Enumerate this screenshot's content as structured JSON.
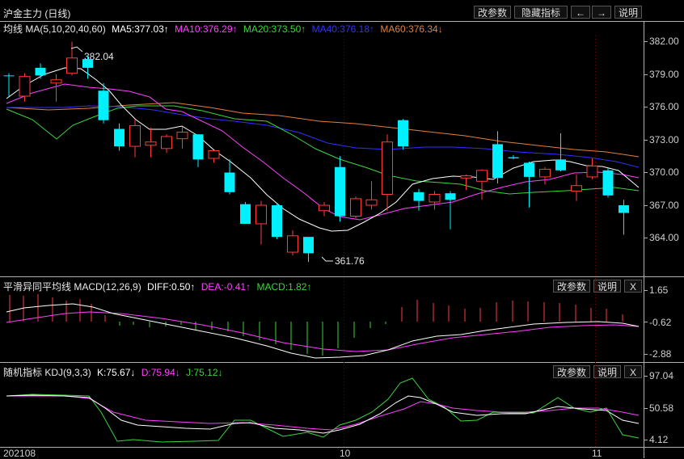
{
  "header": {
    "title": "沪金主力 (日线)",
    "buttons": {
      "modify_params": "改参数",
      "hide_indicator": "隐藏指标",
      "prev": "←",
      "next": "→",
      "help": "说明"
    }
  },
  "main": {
    "ma_info": {
      "label": "均线 MA(5,10,20,40,60)",
      "ma5": "MA5:377.03↑",
      "ma10": "MA10:376.29↑",
      "ma20": "MA20:373.50↑",
      "ma40": "MA40:376.18↑",
      "ma60": "MA60:376.34↓"
    },
    "price_ticks": [
      "382.00",
      "379.00",
      "376.00",
      "373.00",
      "370.00",
      "367.00",
      "364.00"
    ],
    "annotations": {
      "high": "382.04",
      "low": "361.76"
    }
  },
  "macd_pane": {
    "info": {
      "label": "平滑异同平均线 MACD(12,26,9)",
      "diff": "DIFF:0.50↑",
      "dea": "DEA:-0.41↑",
      "macd": "MACD:1.82↑"
    },
    "ticks": [
      "1.65",
      "-0.62",
      "-2.88"
    ],
    "buttons": {
      "modify_params": "改参数",
      "help": "说明",
      "close": "X"
    }
  },
  "kdj_pane": {
    "info": {
      "label": "随机指标 KDJ(9,3,3)",
      "k": "K:75.67↓",
      "d": "D:75.94↓",
      "j": "J:75.12↓"
    },
    "ticks": [
      "97.04",
      "50.58",
      "4.12"
    ],
    "buttons": {
      "modify_params": "改参数",
      "help": "说明",
      "close": "X"
    }
  },
  "x_axis": {
    "labels": [
      "202108",
      "10",
      "11"
    ]
  },
  "colors": {
    "up": "#ff3b3b",
    "down": "#00f0ff",
    "ma5": "#ffffff",
    "ma10": "#ff40ff",
    "ma20": "#3cd63c",
    "ma40": "#3030ff",
    "ma60": "#e08040"
  },
  "chart_data": {
    "type": "candlestick",
    "ylim": [
      362.5,
      383.5
    ],
    "candles": [
      {
        "o": 378.9,
        "h": 379.1,
        "l": 377.0,
        "c": 378.9,
        "dir": "down"
      },
      {
        "o": 377.0,
        "h": 379.1,
        "l": 376.5,
        "c": 378.8,
        "dir": "up"
      },
      {
        "o": 379.6,
        "h": 380.0,
        "l": 378.6,
        "c": 378.9,
        "dir": "down"
      },
      {
        "o": 378.2,
        "h": 379.0,
        "l": 376.5,
        "c": 378.5,
        "dir": "up"
      },
      {
        "o": 379.1,
        "h": 382.0,
        "l": 378.9,
        "c": 380.5,
        "dir": "up"
      },
      {
        "o": 380.4,
        "h": 380.7,
        "l": 378.6,
        "c": 379.6,
        "dir": "down"
      },
      {
        "o": 377.5,
        "h": 378.2,
        "l": 374.5,
        "c": 374.8,
        "dir": "down"
      },
      {
        "o": 374.0,
        "h": 374.5,
        "l": 372.0,
        "c": 372.4,
        "dir": "down"
      },
      {
        "o": 372.4,
        "h": 374.9,
        "l": 371.4,
        "c": 374.3,
        "dir": "up"
      },
      {
        "o": 372.5,
        "h": 374.1,
        "l": 371.4,
        "c": 372.8,
        "dir": "up"
      },
      {
        "o": 372.2,
        "h": 373.5,
        "l": 371.8,
        "c": 373.3,
        "dir": "up"
      },
      {
        "o": 373.1,
        "h": 374.2,
        "l": 372.2,
        "c": 373.7,
        "dir": "up"
      },
      {
        "o": 373.5,
        "h": 373.5,
        "l": 370.5,
        "c": 371.2,
        "dir": "down"
      },
      {
        "o": 371.3,
        "h": 372.0,
        "l": 370.9,
        "c": 372.0,
        "dir": "up"
      },
      {
        "o": 370.0,
        "h": 371.2,
        "l": 368.0,
        "c": 368.2,
        "dir": "down"
      },
      {
        "o": 367.1,
        "h": 367.3,
        "l": 365.3,
        "c": 365.3,
        "dir": "down"
      },
      {
        "o": 365.3,
        "h": 367.4,
        "l": 363.4,
        "c": 367.0,
        "dir": "up"
      },
      {
        "o": 367.0,
        "h": 367.1,
        "l": 363.9,
        "c": 364.1,
        "dir": "down"
      },
      {
        "o": 362.7,
        "h": 364.7,
        "l": 362.4,
        "c": 364.2,
        "dir": "up"
      },
      {
        "o": 364.1,
        "h": 364.1,
        "l": 361.8,
        "c": 362.6,
        "dir": "down"
      },
      {
        "o": 366.5,
        "h": 367.3,
        "l": 366.0,
        "c": 367.0,
        "dir": "up"
      },
      {
        "o": 370.5,
        "h": 371.5,
        "l": 365.5,
        "c": 366.0,
        "dir": "down"
      },
      {
        "o": 366.0,
        "h": 367.8,
        "l": 365.8,
        "c": 367.6,
        "dir": "up"
      },
      {
        "o": 367.0,
        "h": 369.2,
        "l": 366.6,
        "c": 367.5,
        "dir": "up"
      },
      {
        "o": 368.0,
        "h": 373.5,
        "l": 366.5,
        "c": 372.8,
        "dir": "up"
      },
      {
        "o": 374.8,
        "h": 374.9,
        "l": 372.1,
        "c": 372.4,
        "dir": "down"
      },
      {
        "o": 368.2,
        "h": 368.5,
        "l": 366.5,
        "c": 367.4,
        "dir": "down"
      },
      {
        "o": 367.3,
        "h": 368.3,
        "l": 366.6,
        "c": 368.0,
        "dir": "up"
      },
      {
        "o": 368.1,
        "h": 368.3,
        "l": 364.8,
        "c": 367.5,
        "dir": "down"
      },
      {
        "o": 369.5,
        "h": 369.8,
        "l": 368.4,
        "c": 369.7,
        "dir": "up"
      },
      {
        "o": 369.2,
        "h": 370.3,
        "l": 367.5,
        "c": 370.2,
        "dir": "up"
      },
      {
        "o": 372.6,
        "h": 373.8,
        "l": 369.0,
        "c": 369.5,
        "dir": "down"
      },
      {
        "o": 371.4,
        "h": 371.6,
        "l": 371.2,
        "c": 371.3,
        "dir": "down"
      },
      {
        "o": 369.6,
        "h": 371.0,
        "l": 366.8,
        "c": 370.9,
        "dir": "down"
      },
      {
        "o": 369.6,
        "h": 370.5,
        "l": 368.9,
        "c": 370.3,
        "dir": "up"
      },
      {
        "o": 371.2,
        "h": 373.6,
        "l": 370.1,
        "c": 370.2,
        "dir": "down"
      },
      {
        "o": 368.3,
        "h": 369.8,
        "l": 367.4,
        "c": 368.8,
        "dir": "up"
      },
      {
        "o": 369.6,
        "h": 371.3,
        "l": 369.4,
        "c": 370.6,
        "dir": "up"
      },
      {
        "o": 370.2,
        "h": 370.4,
        "l": 367.7,
        "c": 367.9,
        "dir": "down"
      },
      {
        "o": 367.0,
        "h": 367.5,
        "l": 364.3,
        "c": 366.3,
        "dir": "down"
      }
    ]
  }
}
